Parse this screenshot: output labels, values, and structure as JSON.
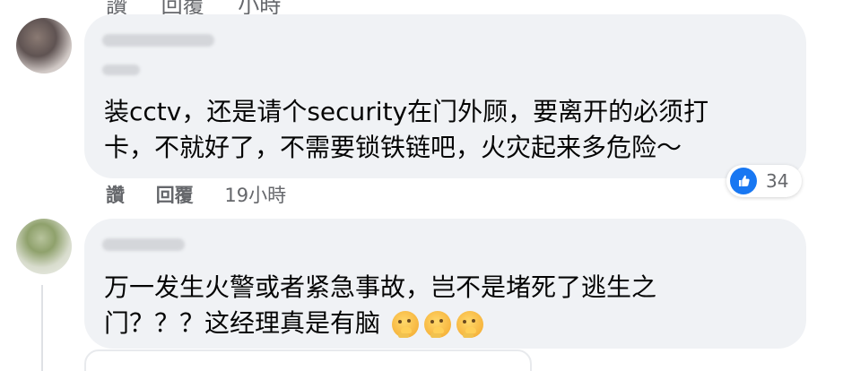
{
  "top_actions": {
    "like_label": "讚",
    "reply_label": "回覆",
    "time_label": "小時"
  },
  "comments": [
    {
      "text_line_1": "装cctv，还是请个security在门外顾，要离开的必须打",
      "text_line_2": "卡，不就好了，不需要锁铁链吧，火灾起来多危险～",
      "reaction_count": "34",
      "actions": {
        "like": "讚",
        "reply": "回覆",
        "time": "19小時"
      }
    },
    {
      "text_line_1": "万一发生火警或者紧急事故，岂不是堵死了逃生之",
      "text_line_2": "门？？？这经理真是有脑"
    }
  ],
  "icons": {
    "like": "like-icon",
    "thinking": "thinking-face-icon"
  },
  "colors": {
    "bubble": "#f0f2f5",
    "text": "#050505",
    "muted": "#65676b",
    "like_blue": "#1877f2"
  }
}
